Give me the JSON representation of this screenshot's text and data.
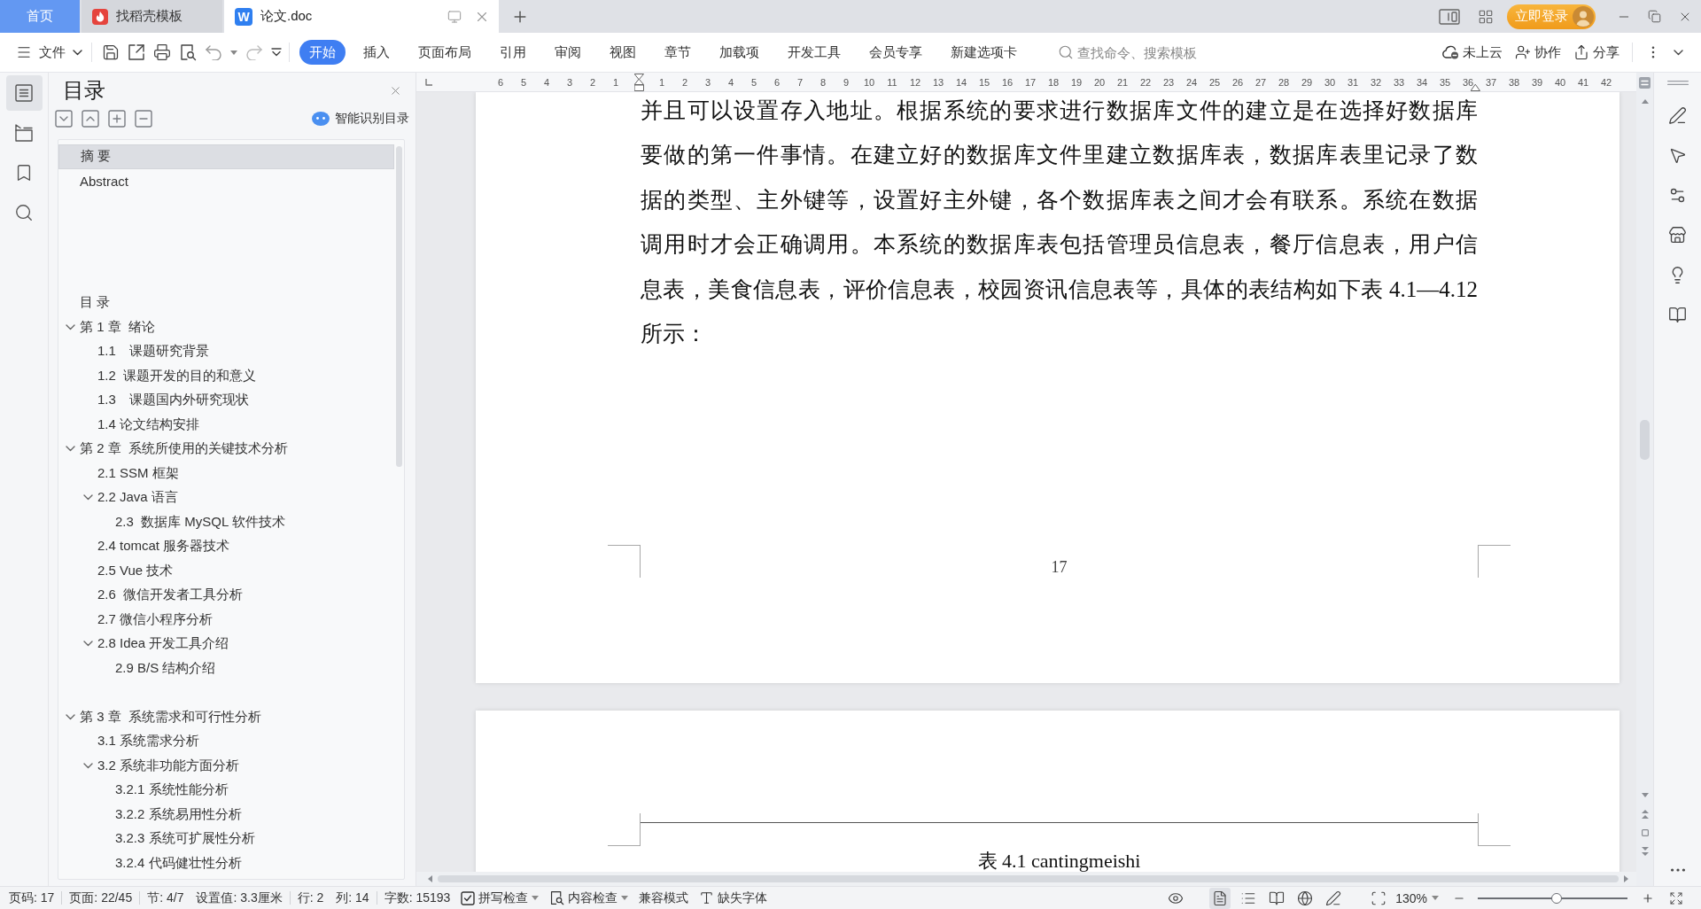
{
  "tabs": [
    {
      "kind": "home",
      "label": "首页",
      "selected": false
    },
    {
      "kind": "docer",
      "label": "找稻壳模板",
      "selected": false
    },
    {
      "kind": "document",
      "label": "论文.doc",
      "logo": "W",
      "selected": true
    }
  ],
  "login_button": "立即登录",
  "toolbar": {
    "file_menu": "文件",
    "ribbon_tabs": [
      {
        "label": "开始",
        "selected": true
      },
      {
        "label": "插入",
        "selected": false
      },
      {
        "label": "页面布局",
        "selected": false
      },
      {
        "label": "引用",
        "selected": false
      },
      {
        "label": "审阅",
        "selected": false
      },
      {
        "label": "视图",
        "selected": false
      },
      {
        "label": "章节",
        "selected": false
      },
      {
        "label": "加载项",
        "selected": false
      },
      {
        "label": "开发工具",
        "selected": false
      },
      {
        "label": "会员专享",
        "selected": false
      },
      {
        "label": "新建选项卡",
        "selected": false
      }
    ],
    "search": {
      "placeholder": "查找命令、搜索模板"
    },
    "cloud_status": "未上云",
    "collaborate": "协作",
    "share": "分享"
  },
  "left_rail": [
    {
      "kind": "outline",
      "selected": true
    },
    {
      "kind": "chapters",
      "selected": false
    },
    {
      "kind": "bookmarks",
      "selected": false
    },
    {
      "kind": "search",
      "selected": false
    }
  ],
  "toc_panel": {
    "title": "目录",
    "smart_button": "智能识别目录",
    "items": [
      {
        "kind": "heading",
        "text": "摘 要",
        "selected": true
      },
      {
        "kind": "heading",
        "text": "Abstract",
        "selected": false
      },
      {
        "kind": "blank",
        "selected": false
      },
      {
        "kind": "blank",
        "selected": false
      },
      {
        "kind": "blank",
        "selected": false
      },
      {
        "kind": "blank",
        "selected": false
      },
      {
        "kind": "heading",
        "text": "目 录",
        "selected": false
      },
      {
        "kind": "heading",
        "text": "第 1 章  绪论",
        "selected": false,
        "expanded": true,
        "children": [
          {
            "kind": "heading",
            "text": "1.1　课题研究背景",
            "selected": false
          },
          {
            "kind": "heading",
            "text": "1.2  课题开发的目的和意义",
            "selected": false
          },
          {
            "kind": "heading",
            "text": "1.3　课题国内外研究现状",
            "selected": false
          },
          {
            "kind": "heading",
            "text": "1.4 论文结构安排",
            "selected": false
          }
        ]
      },
      {
        "kind": "heading",
        "text": "第 2 章  系统所使用的关键技术分析",
        "selected": false,
        "expanded": true,
        "children": [
          {
            "kind": "heading",
            "text": "2.1 SSM 框架",
            "selected": false
          },
          {
            "kind": "heading",
            "text": "2.2 Java 语言",
            "selected": false,
            "expanded": true,
            "children": [
              {
                "kind": "heading",
                "text": "2.3  数据库 MySQL 软件技术",
                "selected": false
              }
            ]
          },
          {
            "kind": "heading",
            "text": "2.4 tomcat 服务器技术",
            "selected": false
          },
          {
            "kind": "heading",
            "text": "2.5 Vue 技术",
            "selected": false
          },
          {
            "kind": "heading",
            "text": "2.6  微信开发者工具分析",
            "selected": false
          },
          {
            "kind": "heading",
            "text": "2.7 微信小程序分析",
            "selected": false
          },
          {
            "kind": "heading",
            "text": "2.8 Idea 开发工具介绍",
            "selected": false,
            "expanded": true,
            "children": [
              {
                "kind": "heading",
                "text": "2.9 B/S 结构介绍",
                "selected": false
              }
            ]
          }
        ]
      },
      {
        "kind": "blank",
        "selected": false
      },
      {
        "kind": "heading",
        "text": "第 3 章  系统需求和可行性分析",
        "selected": false,
        "expanded": true,
        "children": [
          {
            "kind": "heading",
            "text": "3.1 系统需求分析",
            "selected": false
          },
          {
            "kind": "heading",
            "text": "3.2 系统非功能方面分析",
            "selected": false,
            "expanded": true,
            "children": [
              {
                "kind": "heading",
                "text": "3.2.1 系统性能分析",
                "selected": false
              },
              {
                "kind": "heading",
                "text": "3.2.2 系统易用性分析",
                "selected": false
              },
              {
                "kind": "heading",
                "text": "3.2.3 系统可扩展性分析",
                "selected": false
              },
              {
                "kind": "heading",
                "text": "3.2.4 代码健壮性分析",
                "selected": false
              }
            ]
          }
        ]
      }
    ]
  },
  "ruler": {
    "left_numbers": [
      "6",
      "5",
      "4",
      "3",
      "2",
      "1"
    ],
    "right_numbers": [
      "1",
      "2",
      "3",
      "4",
      "5",
      "6",
      "7",
      "8",
      "9",
      "10",
      "11",
      "12",
      "13",
      "14",
      "15",
      "16",
      "17",
      "18",
      "19",
      "20",
      "21",
      "22",
      "23",
      "24",
      "25",
      "26",
      "27",
      "28",
      "29",
      "30",
      "31",
      "32",
      "33",
      "34",
      "35",
      "36",
      "37",
      "38",
      "39",
      "40",
      "41",
      "42"
    ]
  },
  "document": {
    "lines": [
      "并且可以设置存入地址。根据系统的要求进行数据库文件的建立是在选择好数据库",
      "要做的第一件事情。在建立好的数据库文件里建立数据库表，数据库表里记录了数",
      "据的类型、主外键等，设置好主外键，各个数据库表之间才会有联系。系统在数据",
      "调用时才会正确调用。本系统的数据库表包括管理员信息表，餐厅信息表，用户信",
      "息表，美食信息表，评价信息表，校园资讯信息表等，具体的表结构如下表 4.1—4.12",
      "所示："
    ],
    "page_number": "17",
    "caption": "表 4.1 cantingmeishi"
  },
  "status_bar": {
    "groups": [
      [
        "页码: 17"
      ],
      [
        "页面: 22/45"
      ],
      [
        "节: 4/7",
        "设置值: 3.3厘米"
      ],
      [
        "行: 2",
        "列: 14"
      ],
      [
        "字数: 15193"
      ]
    ],
    "tools": [
      {
        "kind": "spell",
        "label": "拼写检查",
        "dropdown": true
      },
      {
        "kind": "review",
        "label": "内容检查",
        "dropdown": true
      },
      {
        "kind": "plain",
        "label": "兼容模式",
        "dropdown": false
      },
      {
        "kind": "font",
        "label": "缺失字体",
        "dropdown": false
      }
    ],
    "views": [
      {
        "kind": "page",
        "selected": true
      },
      {
        "kind": "outline",
        "selected": false
      },
      {
        "kind": "reading",
        "selected": false
      },
      {
        "kind": "web",
        "selected": false
      },
      {
        "kind": "writing",
        "selected": false
      }
    ],
    "zoom": {
      "label": "130%",
      "level": 0.53
    }
  }
}
